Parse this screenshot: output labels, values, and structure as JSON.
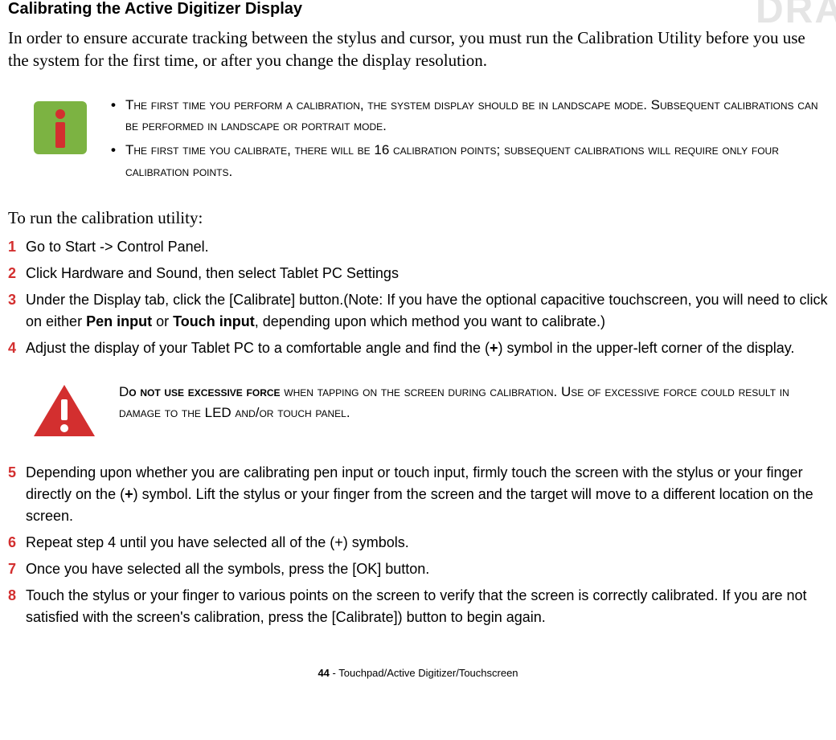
{
  "watermark": "DRA",
  "title": "Calibrating the Active Digitizer Display",
  "intro": "In order to ensure accurate tracking between the stylus and cursor, you must run the Calibration Utility before you use the system for the first time, or after you change the display resolution.",
  "info_callout": {
    "bullets": [
      "The first time you perform a calibration, the system display should be in landscape mode. Subsequent calibrations can be performed in landscape or portrait mode.",
      "The first time you calibrate, there will be 16 calibration points; subsequent calibrations will require only four calibration points."
    ]
  },
  "section_lead": "To run the calibration utility:",
  "steps": [
    {
      "num": "1",
      "text_parts": [
        "Go to Start -> Control Panel."
      ]
    },
    {
      "num": "2",
      "text_parts": [
        "Click Hardware and Sound, then select Tablet PC Settings"
      ]
    },
    {
      "num": "3",
      "text_parts": [
        "Under the Display tab, click the [Calibrate] button.(Note: If you have the optional capacitive touchscreen, you will need to click on either ",
        "Pen input",
        " or ",
        "Touch input",
        ", depending upon which method you want to calibrate.)"
      ]
    },
    {
      "num": "4",
      "text_parts": [
        "Adjust the display of your Tablet PC to a comfortable angle and find the (",
        "+",
        ") symbol in the upper-left corner of the display."
      ]
    }
  ],
  "warning_callout": {
    "pre": "D",
    "not": "o not use excessive force",
    "rest": " when tapping on the screen during calibration. Use of excessive force could result in damage to the LED and/or touch panel."
  },
  "steps2": [
    {
      "num": "5",
      "text_parts": [
        "Depending upon whether you are calibrating pen input or touch input, firmly touch the screen with the stylus or your finger directly on the (",
        "+",
        ") symbol. Lift the stylus or your finger from the screen and the target will move to a different location on the screen."
      ]
    },
    {
      "num": "6",
      "text_parts": [
        "Repeat step 4 until you have selected all of the (+) symbols."
      ]
    },
    {
      "num": "7",
      "text_parts": [
        "Once you have selected all the symbols, press the [OK] button."
      ]
    },
    {
      "num": "8",
      "text_parts": [
        "Touch the stylus or your finger to various points on the screen to verify that the screen is correctly calibrated. If you are not satisfied with the screen's calibration, press the [Calibrate]) button to begin again."
      ]
    }
  ],
  "footer": {
    "page": "44",
    "sep": " - ",
    "label": "Touchpad/Active Digitizer/Touchscreen"
  }
}
